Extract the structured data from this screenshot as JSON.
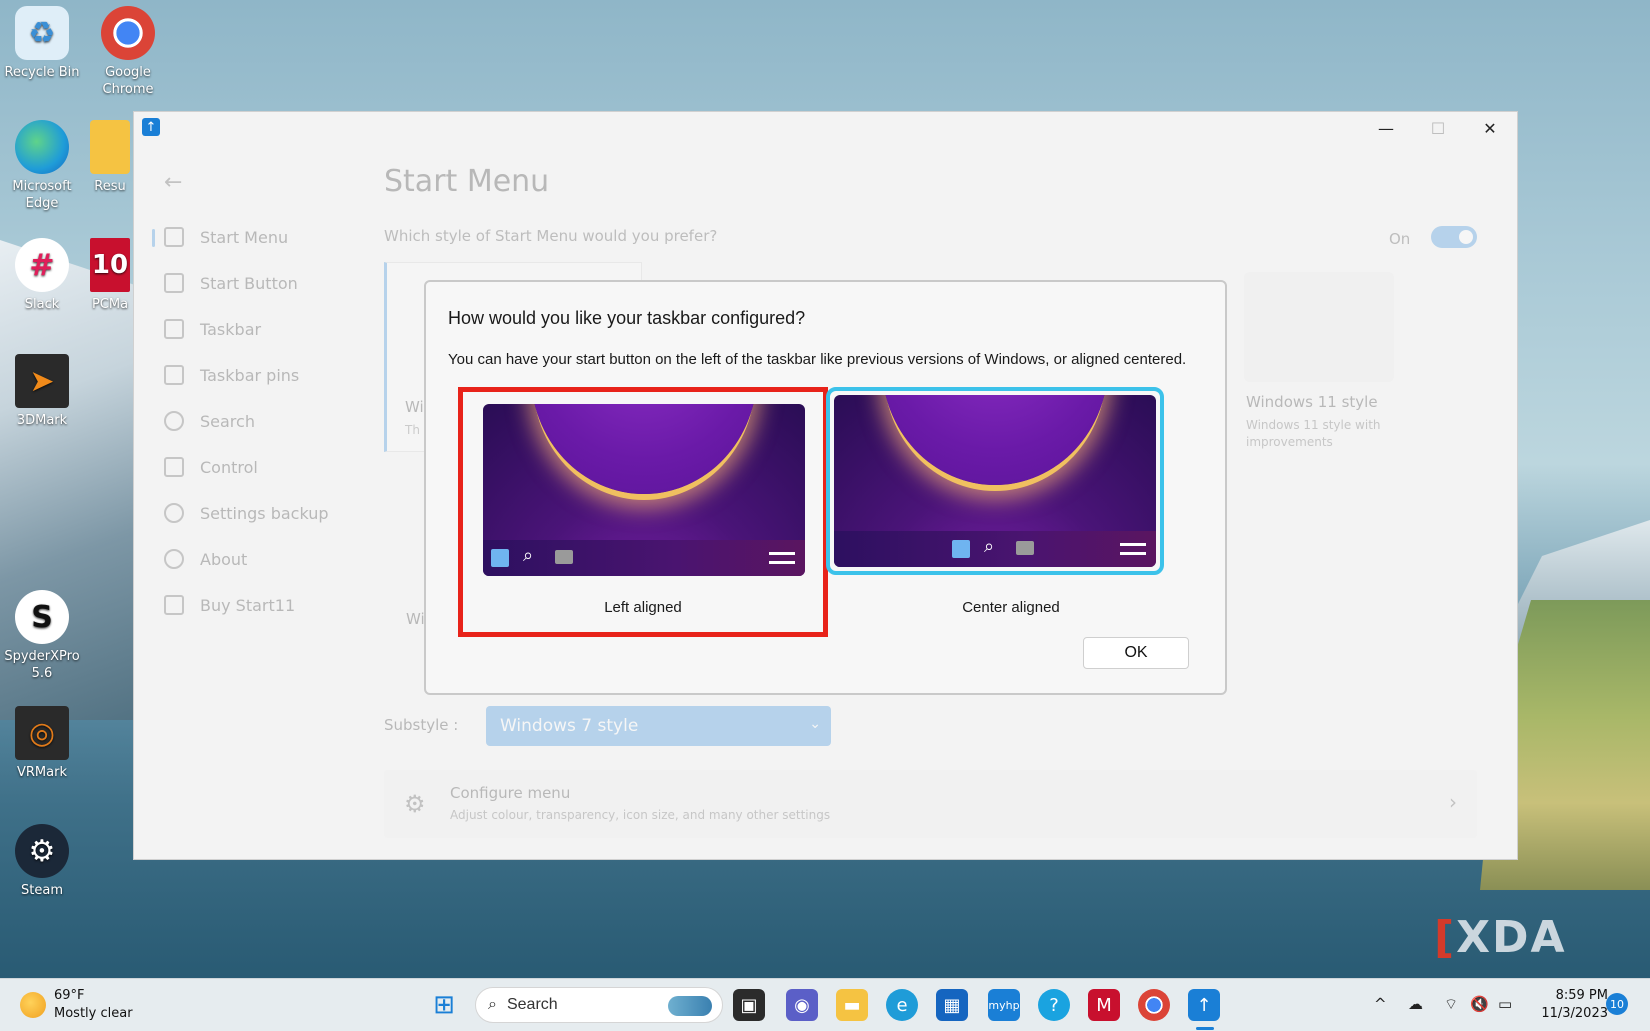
{
  "desktop": {
    "icons": [
      {
        "label": "Recycle Bin",
        "icon": "recycle-bin-icon",
        "glyph": "♻",
        "color": "#5aa7e0"
      },
      {
        "label": "Google Chrome",
        "icon": "chrome-icon",
        "glyph": "◉",
        "color": "#db4437"
      },
      {
        "label": "Microsoft Edge",
        "icon": "edge-icon",
        "glyph": "e",
        "color": "#1f9cd8"
      },
      {
        "label": "Resu",
        "icon": "folder-icon",
        "glyph": "▬",
        "color": "#f5c342"
      },
      {
        "label": "Slack",
        "icon": "slack-icon",
        "glyph": "#",
        "color": "#ffffff"
      },
      {
        "label": "PCMa",
        "icon": "pcmark-icon",
        "glyph": "10",
        "color": "#c8102e"
      },
      {
        "label": "3DMark",
        "icon": "3dmark-icon",
        "glyph": "➤",
        "color": "#2a2a2a"
      },
      {
        "label": "SpyderXPro 5.6",
        "icon": "spyderxpro-icon",
        "glyph": "S",
        "color": "#ffffff"
      },
      {
        "label": "VRMark",
        "icon": "vrmark-icon",
        "glyph": "◎",
        "color": "#e07a1a"
      },
      {
        "label": "Steam",
        "icon": "steam-icon",
        "glyph": "⚙",
        "color": "#1b2838"
      }
    ]
  },
  "app": {
    "back_label": "←",
    "nav": [
      {
        "label": "Start Menu"
      },
      {
        "label": "Start Button"
      },
      {
        "label": "Taskbar"
      },
      {
        "label": "Taskbar pins"
      },
      {
        "label": "Search"
      },
      {
        "label": "Control"
      },
      {
        "label": "Settings backup"
      },
      {
        "label": "About"
      },
      {
        "label": "Buy Start11"
      }
    ],
    "page_title": "Start Menu",
    "page_question": "Which style of Start Menu would you prefer?",
    "toggle_label": "On",
    "card1_title_partial": "Wi",
    "card1_desc_partial": "Th",
    "card3_title": "Windows 11 style",
    "card3_desc": "Windows 11 style with improvements",
    "sub_card_partial": "Wi",
    "substyle_label": "Substyle :",
    "substyle_value": "Windows 7 style",
    "configure_title": "Configure menu",
    "configure_desc": "Adjust colour, transparency, icon size, and many other settings"
  },
  "dialog": {
    "title": "How would you like your taskbar configured?",
    "description": "You can have your start button on the left of the taskbar like previous versions of Windows, or aligned centered.",
    "options": [
      {
        "label": "Left aligned",
        "highlight_color": "#e8231a"
      },
      {
        "label": "Center aligned",
        "selected_color": "#3cc2ea"
      }
    ],
    "ok_label": "OK"
  },
  "watermark": {
    "bracket": "[",
    "text": "XDA"
  },
  "taskbar": {
    "weather_temp": "69°F",
    "weather_desc": "Mostly clear",
    "search_placeholder": "Search",
    "time": "8:59 PM",
    "date": "11/3/2023",
    "notification_count": "10"
  }
}
